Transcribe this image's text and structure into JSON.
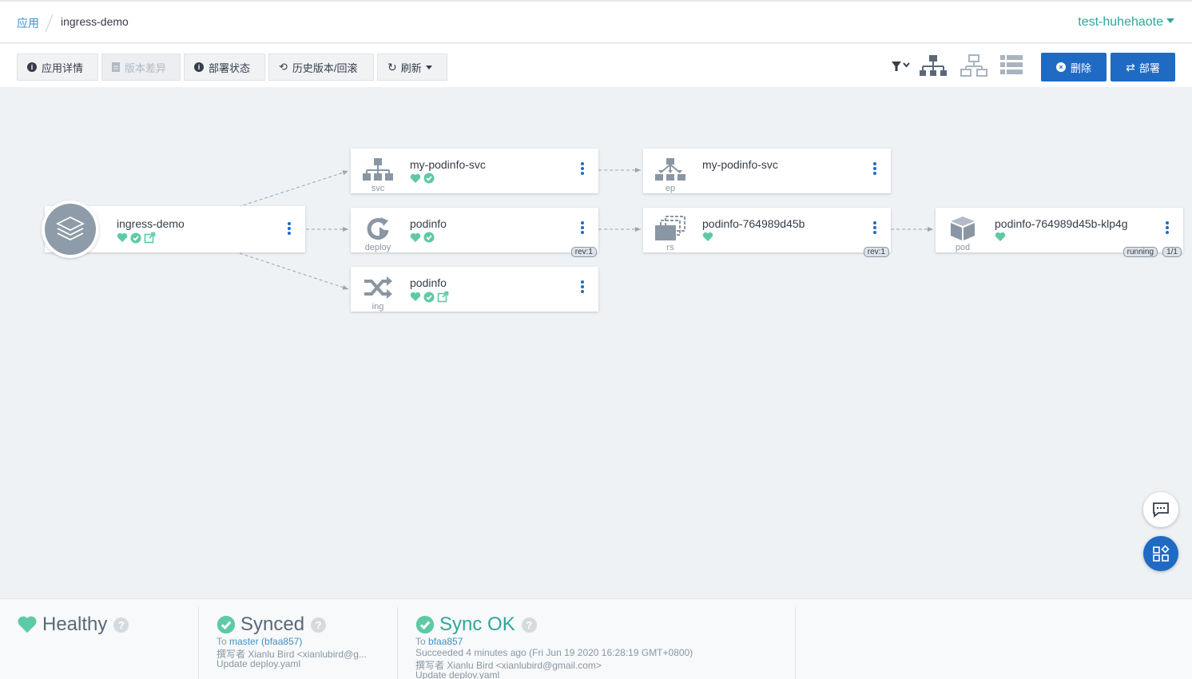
{
  "breadcrumb": {
    "root": "应用",
    "current": "ingress-demo"
  },
  "project": "test-huhehaote",
  "toolbar": {
    "app_details": "应用详情",
    "app_diff": "版本差异",
    "sync_status": "部署状态",
    "history": "历史版本/回滚",
    "refresh": "刷新",
    "delete": "删除",
    "sync": "部署"
  },
  "nodes": {
    "app": {
      "name": "ingress-demo"
    },
    "svc": {
      "name": "my-podinfo-svc",
      "kind": "svc"
    },
    "ep": {
      "name": "my-podinfo-svc",
      "kind": "ep"
    },
    "deploy": {
      "name": "podinfo",
      "kind": "deploy",
      "badge": "rev:1"
    },
    "rs": {
      "name": "podinfo-764989d45b",
      "kind": "rs",
      "badge": "rev:1"
    },
    "pod": {
      "name": "podinfo-764989d45b-klp4g",
      "kind": "pod",
      "badge1": "running",
      "badge2": "1/1"
    },
    "ing": {
      "name": "podinfo",
      "kind": "ing"
    }
  },
  "status": {
    "health": {
      "title": "Healthy"
    },
    "sync": {
      "title": "Synced",
      "to_label": "To",
      "revision": "master (bfaa857)",
      "author": "撰写者 Xianlu Bird <xianlubird@g...",
      "message": "Update deploy.yaml"
    },
    "operation": {
      "title": "Sync OK",
      "to_label": "To",
      "revision": "bfaa857",
      "succeeded": "Succeeded 4 minutes ago (Fri Jun 19 2020 16:28:19 GMT+0800)",
      "author": "撰写者 Xianlu Bird <xianlubird@gmail.com>",
      "message": "Update deploy.yaml"
    }
  },
  "colors": {
    "accent": "#2fa69c",
    "healthy": "#5fc9a6",
    "primary_button": "#1f6bc4",
    "link": "#3f8fc4"
  }
}
